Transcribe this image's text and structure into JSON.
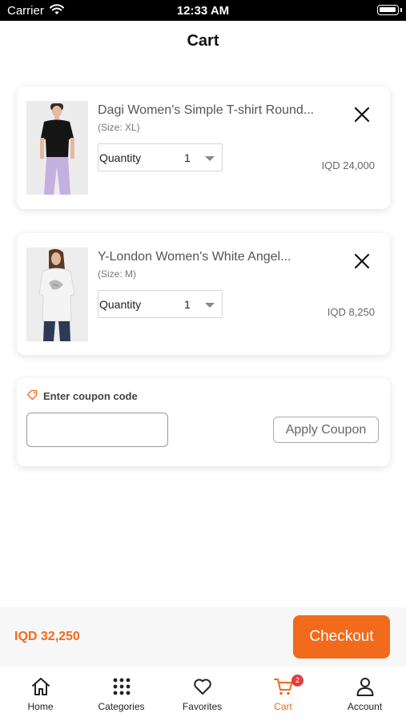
{
  "status_bar": {
    "carrier": "Carrier",
    "time": "12:33 AM"
  },
  "page": {
    "title": "Cart"
  },
  "cart": {
    "quantity_label": "Quantity",
    "items": [
      {
        "name": "Dagi Women's Simple T-shirt Round...",
        "size": "(Size: XL)",
        "quantity": "1",
        "price": "IQD 24,000",
        "image": "woman in black t-shirt and lilac trousers"
      },
      {
        "name": "Y-London Women's White Angel...",
        "size": "(Size: M)",
        "quantity": "1",
        "price": "IQD 8,250",
        "image": "woman in white printed tunic and jeans"
      }
    ]
  },
  "coupon": {
    "label": "Enter coupon code",
    "value": "",
    "button": "Apply Coupon",
    "icon": "tag-icon"
  },
  "checkout": {
    "total": "IQD 32,250",
    "button": "Checkout"
  },
  "tabbar": {
    "tabs": [
      {
        "label": "Home",
        "icon": "home-icon"
      },
      {
        "label": "Categories",
        "icon": "grid-icon"
      },
      {
        "label": "Favorites",
        "icon": "heart-icon"
      },
      {
        "label": "Cart",
        "icon": "cart-icon",
        "badge": "2",
        "active": true
      },
      {
        "label": "Account",
        "icon": "user-icon"
      }
    ]
  },
  "colors": {
    "accent": "#f26a1b",
    "badge": "#e53e3e"
  }
}
